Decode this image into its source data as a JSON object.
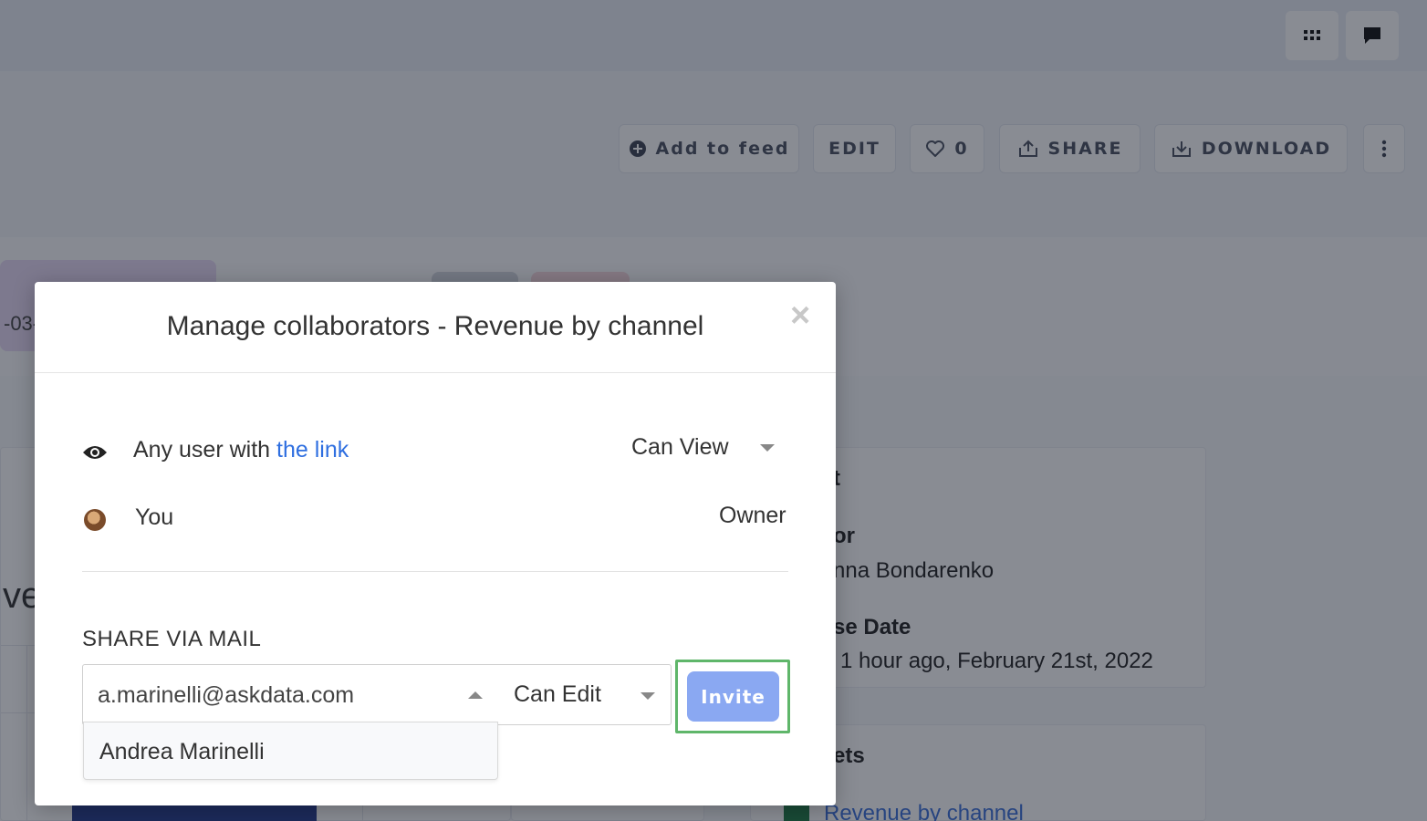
{
  "header": {
    "add_to_feed": "Add to feed",
    "edit": "EDIT",
    "likes": "0",
    "share": "SHARE",
    "download": "DOWNLOAD"
  },
  "background": {
    "date_fragment": "-03-",
    "big_letters": "ve",
    "details": {
      "title_fragment": "t",
      "author_label_fragment": "or",
      "author_name_fragment": "nna Bondarenko",
      "date_label_fragment": "se Date",
      "date_value_fragment": "1 hour ago, February 21st, 2022",
      "assets_label_fragment": "ets",
      "asset_link": "Revenue by channel"
    }
  },
  "modal": {
    "title": "Manage collaborators - Revenue by channel",
    "close_glyph": "×",
    "link_access": {
      "prefix": "Any user with ",
      "link_text": "the link",
      "permission": "Can View"
    },
    "owner_row": {
      "name": "You",
      "role": "Owner"
    },
    "share_via_mail": {
      "label": "SHARE VIA MAIL",
      "email_value": "a.marinelli@askdata.com",
      "role": "Can Edit",
      "suggestion": "Andrea Marinelli",
      "invite_label": "Invite"
    }
  },
  "colors": {
    "link": "#2f6fe0",
    "invite_button": "#8aa8f2",
    "highlight_frame": "#5fb66a",
    "overlay": "rgba(20,26,40,0.5)"
  }
}
